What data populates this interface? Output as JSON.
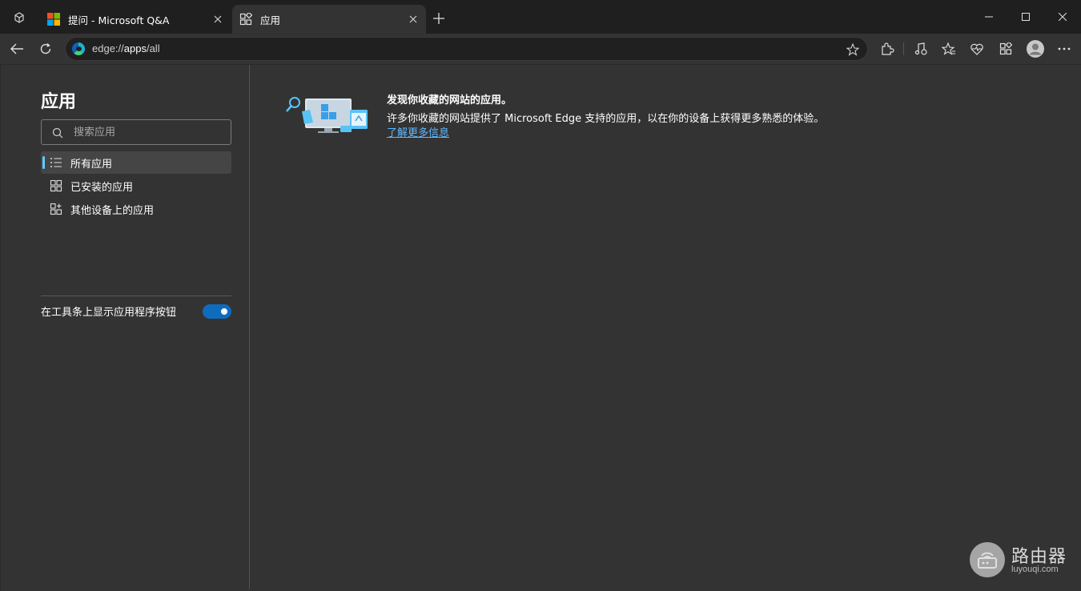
{
  "tabs": [
    {
      "title": "提问 - Microsoft Q&A",
      "icon": "microsoft-logo-icon"
    },
    {
      "title": "应用",
      "icon": "apps-icon",
      "active": true
    }
  ],
  "address": {
    "scheme": "edge://",
    "path": "apps",
    "rest": "/all"
  },
  "sidebar": {
    "title": "应用",
    "search_placeholder": "搜索应用",
    "items": [
      {
        "label": "所有应用",
        "icon": "list-icon",
        "active": true
      },
      {
        "label": "已安装的应用",
        "icon": "installed-apps-icon"
      },
      {
        "label": "其他设备上的应用",
        "icon": "device-apps-icon"
      }
    ],
    "toggle_label": "在工具条上显示应用程序按钮",
    "toggle_on": true
  },
  "hero": {
    "title": "发现你收藏的网站的应用。",
    "description": "许多你收藏的网站提供了 Microsoft Edge 支持的应用，以在你的设备上获得更多熟悉的体验。",
    "link": "了解更多信息"
  },
  "watermark": {
    "name": "路由器",
    "domain": "luyouqi.com"
  },
  "colors": {
    "accent": "#60cdff",
    "toggle": "#0f6cbd",
    "link": "#60b8ff",
    "page_bg": "#333333",
    "frame_bg": "#1f1f1f"
  }
}
